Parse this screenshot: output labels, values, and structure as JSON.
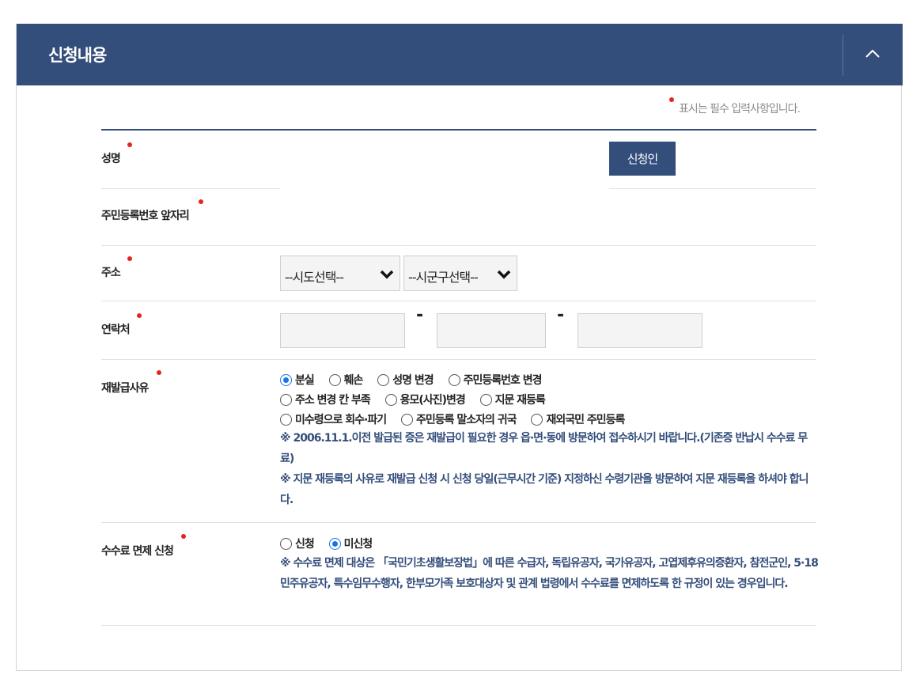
{
  "header": {
    "title": "신청내용"
  },
  "required_note": "표시는 필수 입력사항입니다.",
  "fields": {
    "name": {
      "label": "성명",
      "button": "신청인"
    },
    "rrn": {
      "label": "주민등록번호 앞자리"
    },
    "address": {
      "label": "주소",
      "sido_selected": "--시도선택--",
      "sigungu_selected": "--시군구선택--"
    },
    "contact": {
      "label": "연락처",
      "separator": "-"
    },
    "reason": {
      "label": "재발급사유",
      "options_row1": [
        "분실",
        "훼손",
        "성명 변경",
        "주민등록번호 변경"
      ],
      "options_row2": [
        "주소 변경 칸 부족",
        "용모(사진)변경",
        "지문 재등록"
      ],
      "options_row3": [
        "미수령으로 회수·파기",
        "주민등록 말소자의 귀국",
        "재외국민 주민등록"
      ],
      "selected": "분실",
      "note1": "※ 2006.11.1.이전 발급된 증은 재발급이 필요한 경우 읍·면·동에 방문하여 접수하시기 바랍니다.(기존증 반납시 수수료 무료)",
      "note2": "※ 지문 재등록의 사유로 재발급 신청 시 신청 당일(근무시간 기준) 지정하신 수령기관을 방문하여 지문 재등록을 하셔야 합니다."
    },
    "fee": {
      "label": "수수료 면제 신청",
      "options": [
        "신청",
        "미신청"
      ],
      "selected": "미신청",
      "note": "※ 수수료 면제 대상은 「국민기초생활보장법」에 따른 수급자, 독립유공자, 국가유공자, 고엽제후유의증환자, 참전군인, 5·18민주유공자, 특수임무수행자, 한부모가족 보호대상자 및 관계 법령에서 수수료를 면제하도록 한 규정이 있는 경우입니다."
    }
  },
  "colors": {
    "primary": "#344e7b",
    "required_dot": "#e5241b",
    "radio_selected": "#1a73e8"
  }
}
